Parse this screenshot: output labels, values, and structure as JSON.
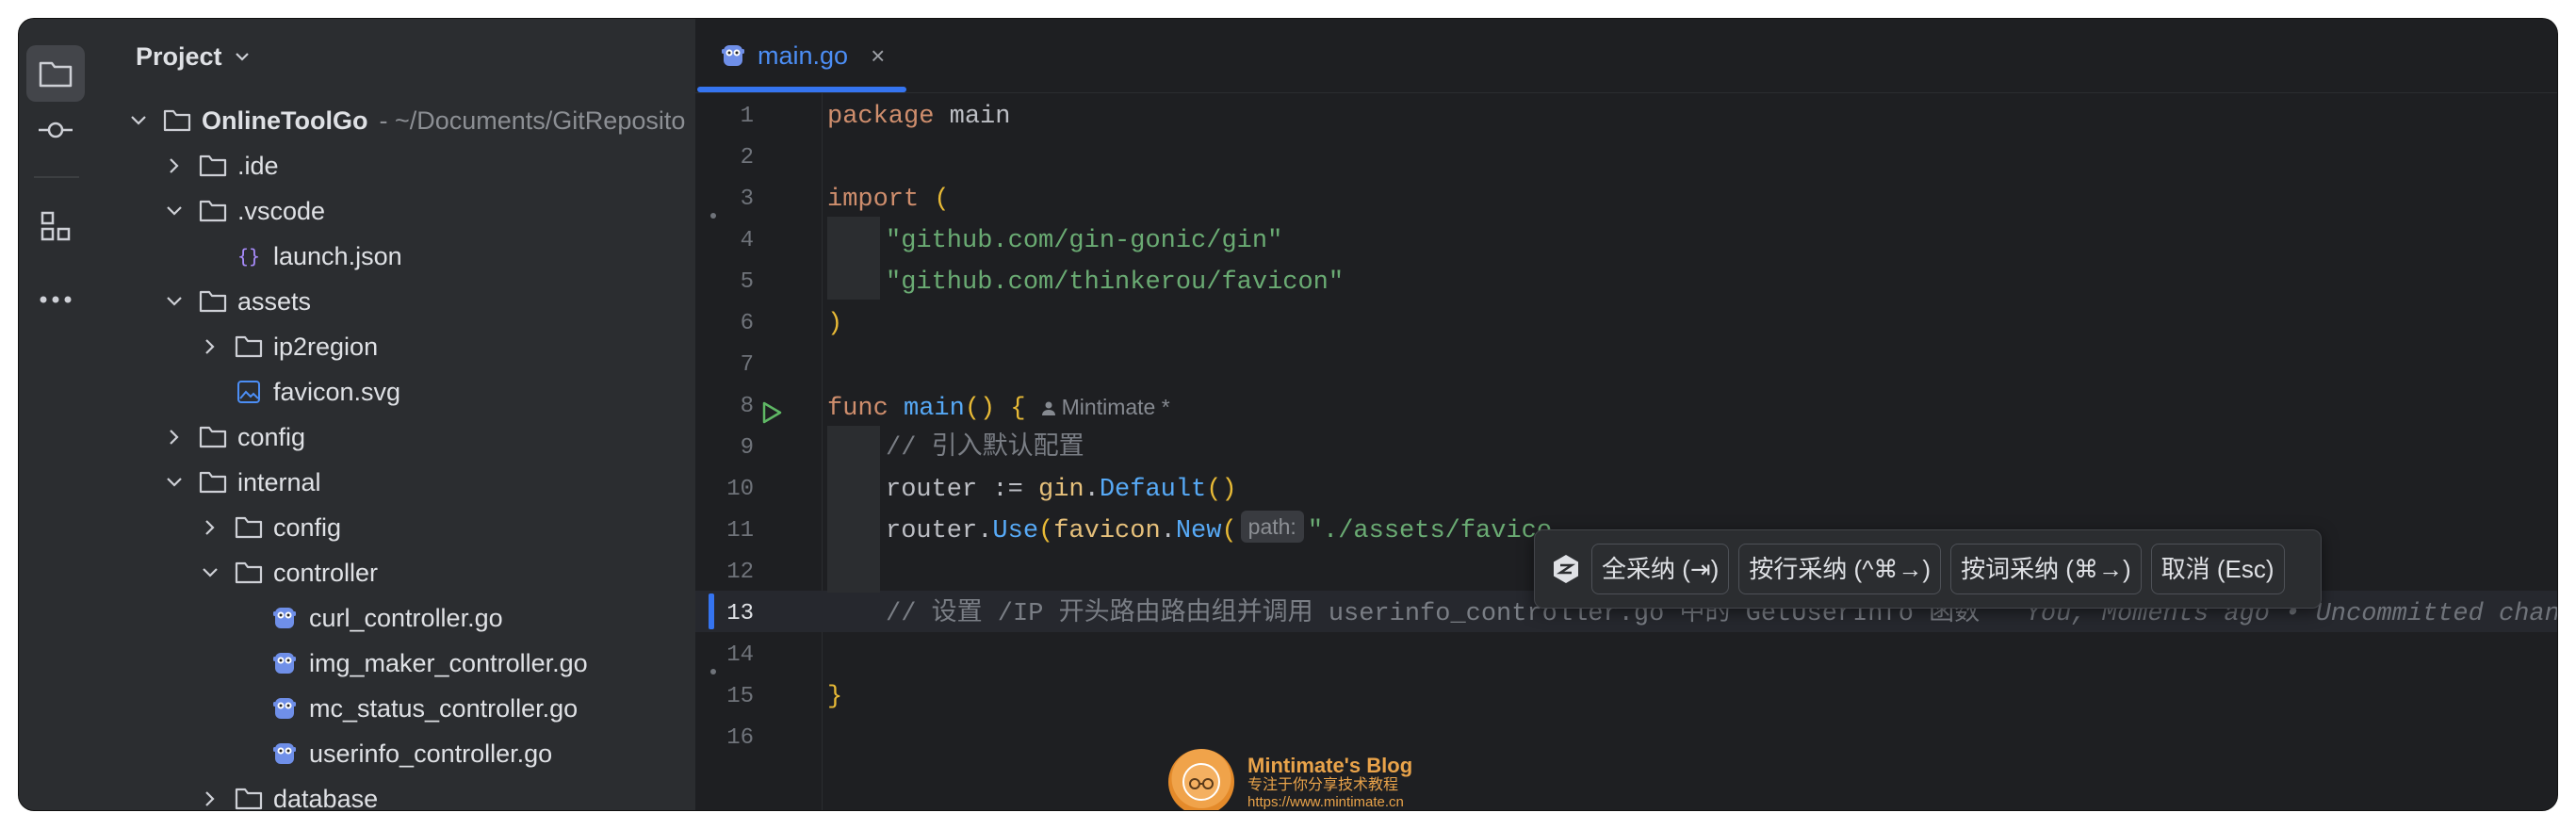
{
  "sidebar": {
    "header": "Project",
    "tree": [
      {
        "label": "OnlineToolGo",
        "sub": "~/Documents/GitReposito",
        "depth": 0,
        "expanded": true,
        "type": "folder",
        "bold": true
      },
      {
        "label": ".ide",
        "depth": 1,
        "expanded": false,
        "type": "folder"
      },
      {
        "label": ".vscode",
        "depth": 1,
        "expanded": true,
        "type": "folder"
      },
      {
        "label": "launch.json",
        "depth": 2,
        "type": "json"
      },
      {
        "label": "assets",
        "depth": 1,
        "expanded": true,
        "type": "folder"
      },
      {
        "label": "ip2region",
        "depth": 2,
        "expanded": false,
        "type": "folder"
      },
      {
        "label": "favicon.svg",
        "depth": 2,
        "type": "image"
      },
      {
        "label": "config",
        "depth": 1,
        "expanded": false,
        "type": "folder"
      },
      {
        "label": "internal",
        "depth": 1,
        "expanded": true,
        "type": "folder"
      },
      {
        "label": "config",
        "depth": 2,
        "expanded": false,
        "type": "folder"
      },
      {
        "label": "controller",
        "depth": 2,
        "expanded": true,
        "type": "folder"
      },
      {
        "label": "curl_controller.go",
        "depth": 3,
        "type": "go"
      },
      {
        "label": "img_maker_controller.go",
        "depth": 3,
        "type": "go"
      },
      {
        "label": "mc_status_controller.go",
        "depth": 3,
        "type": "go"
      },
      {
        "label": "userinfo_controller.go",
        "depth": 3,
        "type": "go"
      },
      {
        "label": "database",
        "depth": 2,
        "expanded": false,
        "type": "folder"
      }
    ]
  },
  "editor": {
    "tab": {
      "label": "main.go",
      "close": "×"
    },
    "line_numbers": [
      "1",
      "2",
      "3",
      "4",
      "5",
      "6",
      "7",
      "8",
      "9",
      "10",
      "11",
      "12",
      "13",
      "14",
      "15",
      "16"
    ],
    "active_line": "13",
    "code": {
      "l1_kw": "package",
      "l1_name": "main",
      "l3_kw": "import",
      "l3_paren": "(",
      "l4_str": "\"github.com/gin-gonic/gin\"",
      "l5_str": "\"github.com/thinkerou/favicon\"",
      "l6_paren": ")",
      "l8_kw": "func",
      "l8_fn": "main",
      "l8_rest": "() {",
      "l8_author": "Mintimate *",
      "l9_cmt": "// 引入默认配置",
      "l10_a": "router := ",
      "l10_pkg": "gin",
      "l10_dot": ".",
      "l10_call": "Default",
      "l10_end": "()",
      "l11_a": "router.",
      "l11_call": "Use",
      "l11_b": "(",
      "l11_pkg": "favicon",
      "l11_dot": ".",
      "l11_call2": "New",
      "l11_c": "(",
      "l11_hint": "path:",
      "l11_str": "\"./assets/favico",
      "l13_cmt": "// 设置 /IP 开头路由路由组并调用 userinfo_controller.go 中的 GetUserInfo 函数",
      "l13_blame": "You, Moments ago • Uncommitted changes",
      "l15_brace": "}"
    }
  },
  "ai_popup": {
    "accept_all": "全采纳 (⇥)",
    "accept_line": "按行采纳 (^⌘→)",
    "accept_word": "按词采纳 (⌘→)",
    "cancel": "取消 (Esc)"
  },
  "watermark": {
    "title": "Mintimate's Blog",
    "subtitle": "专注于你分享技术教程",
    "url": "https://www.mintimate.cn"
  }
}
